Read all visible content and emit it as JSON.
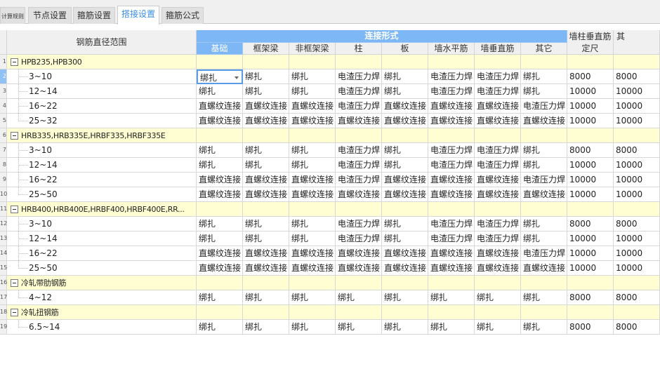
{
  "tabs": [
    {
      "label": "计算规则"
    },
    {
      "label": "节点设置"
    },
    {
      "label": "箍筋设置"
    },
    {
      "label": "搭接设置",
      "active": true
    },
    {
      "label": "箍筋公式"
    }
  ],
  "header": {
    "range": "钢筋直径范围",
    "group": "连接形式",
    "cols": [
      "基础",
      "框架梁",
      "非框架梁",
      "柱",
      "板",
      "墙水平筋",
      "墙垂直筋",
      "其它"
    ],
    "fixed_top": "墙柱垂直筋",
    "fixed_bottom": "定尺",
    "other": "其"
  },
  "groups": [
    {
      "num": "1",
      "name": "HPB235,HPB300",
      "rows": [
        {
          "num": "2",
          "range": "3~10",
          "v": [
            "绑扎",
            "绑扎",
            "绑扎",
            "电渣压力焊",
            "绑扎",
            "电渣压力焊",
            "电渣压力焊",
            "绑扎",
            "8000",
            "8000"
          ]
        },
        {
          "num": "3",
          "range": "12~14",
          "v": [
            "绑扎",
            "绑扎",
            "绑扎",
            "电渣压力焊",
            "绑扎",
            "电渣压力焊",
            "电渣压力焊",
            "绑扎",
            "10000",
            "10000"
          ]
        },
        {
          "num": "4",
          "range": "16~22",
          "v": [
            "直螺纹连接",
            "直螺纹连接",
            "直螺纹连接",
            "电渣压力焊",
            "直螺纹连接",
            "直螺纹连接",
            "直螺纹连接",
            "电渣压力焊",
            "10000",
            "10000"
          ]
        },
        {
          "num": "5",
          "range": "25~32",
          "v": [
            "直螺纹连接",
            "直螺纹连接",
            "直螺纹连接",
            "直螺纹连接",
            "直螺纹连接",
            "直螺纹连接",
            "直螺纹连接",
            "直螺纹连接",
            "10000",
            "10000"
          ]
        }
      ]
    },
    {
      "num": "6",
      "name": "HRB335,HRB335E,HRBF335,HRBF335E",
      "rows": [
        {
          "num": "7",
          "range": "3~10",
          "v": [
            "绑扎",
            "绑扎",
            "绑扎",
            "电渣压力焊",
            "绑扎",
            "电渣压力焊",
            "电渣压力焊",
            "绑扎",
            "8000",
            "8000"
          ]
        },
        {
          "num": "8",
          "range": "12~14",
          "v": [
            "绑扎",
            "绑扎",
            "绑扎",
            "电渣压力焊",
            "绑扎",
            "电渣压力焊",
            "电渣压力焊",
            "绑扎",
            "10000",
            "10000"
          ]
        },
        {
          "num": "9",
          "range": "16~22",
          "v": [
            "直螺纹连接",
            "直螺纹连接",
            "直螺纹连接",
            "电渣压力焊",
            "直螺纹连接",
            "直螺纹连接",
            "直螺纹连接",
            "电渣压力焊",
            "10000",
            "10000"
          ]
        },
        {
          "num": "10",
          "range": "25~50",
          "v": [
            "直螺纹连接",
            "直螺纹连接",
            "直螺纹连接",
            "直螺纹连接",
            "直螺纹连接",
            "直螺纹连接",
            "直螺纹连接",
            "直螺纹连接",
            "10000",
            "10000"
          ]
        }
      ]
    },
    {
      "num": "11",
      "name": "HRB400,HRB400E,HRBF400,HRBF400E,RR...",
      "rows": [
        {
          "num": "12",
          "range": "3~10",
          "v": [
            "绑扎",
            "绑扎",
            "绑扎",
            "电渣压力焊",
            "绑扎",
            "电渣压力焊",
            "电渣压力焊",
            "绑扎",
            "8000",
            "8000"
          ]
        },
        {
          "num": "13",
          "range": "12~14",
          "v": [
            "绑扎",
            "绑扎",
            "绑扎",
            "电渣压力焊",
            "绑扎",
            "电渣压力焊",
            "电渣压力焊",
            "绑扎",
            "10000",
            "10000"
          ]
        },
        {
          "num": "14",
          "range": "16~22",
          "v": [
            "直螺纹连接",
            "直螺纹连接",
            "直螺纹连接",
            "直螺纹连接",
            "直螺纹连接",
            "直螺纹连接",
            "直螺纹连接",
            "电渣压力焊",
            "10000",
            "10000"
          ]
        },
        {
          "num": "15",
          "range": "25~50",
          "v": [
            "直螺纹连接",
            "直螺纹连接",
            "直螺纹连接",
            "直螺纹连接",
            "直螺纹连接",
            "直螺纹连接",
            "直螺纹连接",
            "直螺纹连接",
            "10000",
            "10000"
          ]
        }
      ]
    },
    {
      "num": "16",
      "name": "冷轧带肋钢筋",
      "rows": [
        {
          "num": "17",
          "range": "4~12",
          "v": [
            "绑扎",
            "绑扎",
            "绑扎",
            "绑扎",
            "绑扎",
            "绑扎",
            "绑扎",
            "绑扎",
            "8000",
            "8000"
          ]
        }
      ]
    },
    {
      "num": "18",
      "name": "冷轧扭钢筋",
      "rows": [
        {
          "num": "19",
          "range": "6.5~14",
          "v": [
            "绑扎",
            "绑扎",
            "绑扎",
            "绑扎",
            "绑扎",
            "绑扎",
            "绑扎",
            "绑扎",
            "8000",
            "8000"
          ]
        }
      ]
    }
  ]
}
